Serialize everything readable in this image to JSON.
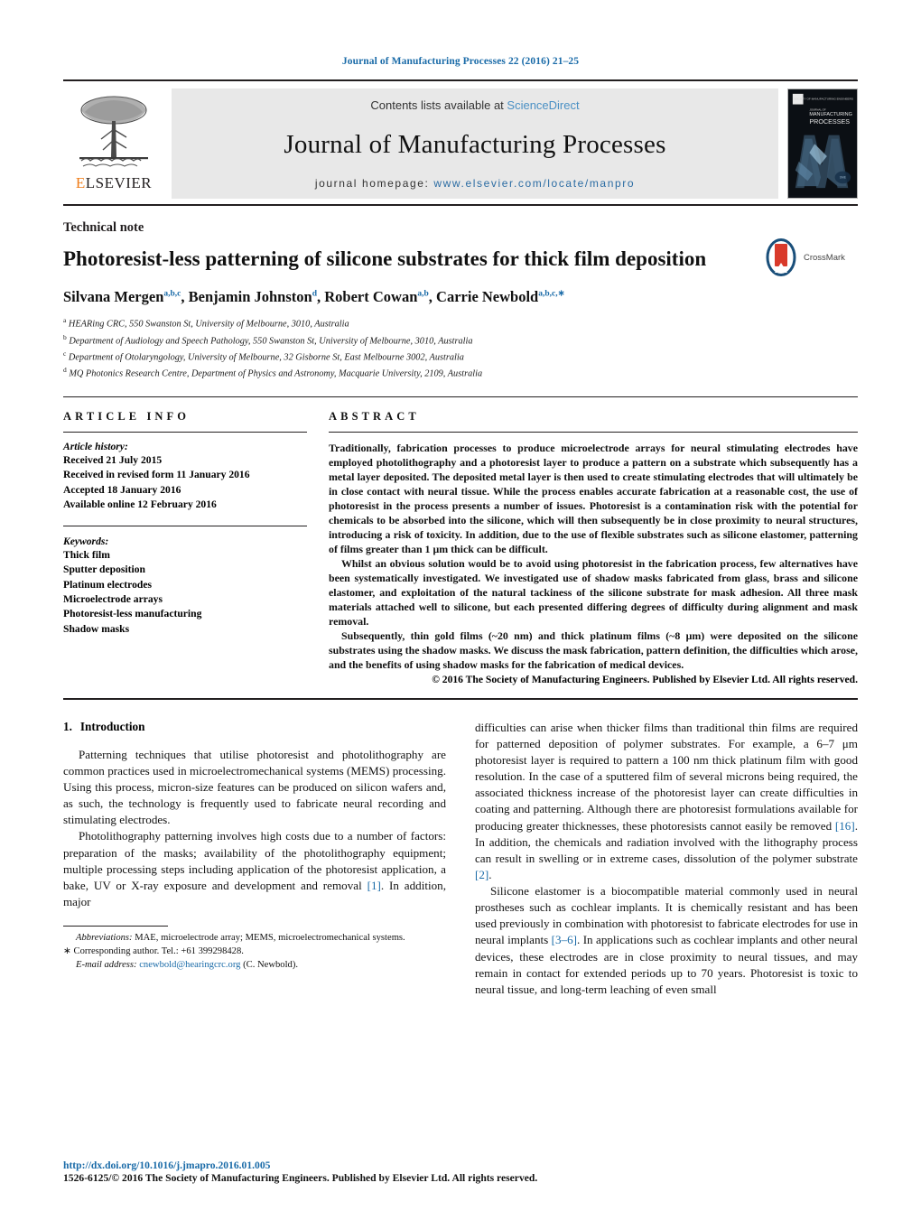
{
  "running_head": "Journal of Manufacturing Processes 22 (2016) 21–25",
  "masthead": {
    "contents_prefix": "Contents lists available at ",
    "sciencedirect": "ScienceDirect",
    "journal_title": "Journal of Manufacturing Processes",
    "homepage_prefix": "journal homepage: ",
    "homepage_url": "www.elsevier.com/locate/manpro",
    "publisher": "ELSEVIER",
    "cover_title_small": "JOURNAL OF",
    "cover_title_1": "MANUFACTURING",
    "cover_title_2": "PROCESSES"
  },
  "article": {
    "doctype": "Technical note",
    "title": "Photoresist-less patterning of silicone substrates for thick film deposition",
    "crossmark_label": "CrossMark",
    "authors": [
      {
        "name": "Silvana Mergen",
        "sup": "a,b,c"
      },
      {
        "name": "Benjamin Johnston",
        "sup": "d"
      },
      {
        "name": "Robert Cowan",
        "sup": "a,b"
      },
      {
        "name": "Carrie Newbold",
        "sup": "a,b,c,∗"
      }
    ],
    "affiliations": [
      {
        "mark": "a",
        "text": "HEARing CRC, 550 Swanston St, University of Melbourne, 3010, Australia"
      },
      {
        "mark": "b",
        "text": "Department of Audiology and Speech Pathology, 550 Swanston St, University of Melbourne, 3010, Australia"
      },
      {
        "mark": "c",
        "text": "Department of Otolaryngology, University of Melbourne, 32 Gisborne St, East Melbourne 3002, Australia"
      },
      {
        "mark": "d",
        "text": "MQ Photonics Research Centre, Department of Physics and Astronomy, Macquarie University, 2109, Australia"
      }
    ]
  },
  "article_info": {
    "heading": "ARTICLE INFO",
    "history_label": "Article history:",
    "history": [
      "Received 21 July 2015",
      "Received in revised form 11 January 2016",
      "Accepted 18 January 2016",
      "Available online 12 February 2016"
    ],
    "keywords_label": "Keywords:",
    "keywords": [
      "Thick film",
      "Sputter deposition",
      "Platinum electrodes",
      "Microelectrode arrays",
      "Photoresist-less manufacturing",
      "Shadow masks"
    ]
  },
  "abstract": {
    "heading": "ABSTRACT",
    "paragraphs": [
      "Traditionally, fabrication processes to produce microelectrode arrays for neural stimulating electrodes have employed photolithography and a photoresist layer to produce a pattern on a substrate which subsequently has a metal layer deposited. The deposited metal layer is then used to create stimulating electrodes that will ultimately be in close contact with neural tissue. While the process enables accurate fabrication at a reasonable cost, the use of photoresist in the process presents a number of issues. Photoresist is a contamination risk with the potential for chemicals to be absorbed into the silicone, which will then subsequently be in close proximity to neural structures, introducing a risk of toxicity. In addition, due to the use of flexible substrates such as silicone elastomer, patterning of films greater than 1 μm thick can be difficult.",
      "Whilst an obvious solution would be to avoid using photoresist in the fabrication process, few alternatives have been systematically investigated. We investigated use of shadow masks fabricated from glass, brass and silicone elastomer, and exploitation of the natural tackiness of the silicone substrate for mask adhesion. All three mask materials attached well to silicone, but each presented differing degrees of difficulty during alignment and mask removal.",
      "Subsequently, thin gold films (~20 nm) and thick platinum films (~8 μm) were deposited on the silicone substrates using the shadow masks. We discuss the mask fabrication, pattern definition, the difficulties which arose, and the benefits of using shadow masks for the fabrication of medical devices."
    ],
    "copyright": "© 2016 The Society of Manufacturing Engineers. Published by Elsevier Ltd. All rights reserved."
  },
  "body": {
    "section_number": "1.",
    "section_title": "Introduction",
    "left_paragraphs": [
      "Patterning techniques that utilise photoresist and photolithography are common practices used in microelectromechanical systems (MEMS) processing. Using this process, micron-size features can be produced on silicon wafers and, as such, the technology is frequently used to fabricate neural recording and stimulating electrodes.",
      "Photolithography patterning involves high costs due to a number of factors: preparation of the masks; availability of the photolithography equipment; multiple processing steps including application of the photoresist application, a bake, UV or X-ray exposure and development and removal [1]. In addition, major"
    ],
    "right_paragraphs": [
      "difficulties can arise when thicker films than traditional thin films are required for patterned deposition of polymer substrates. For example, a 6–7 μm photoresist layer is required to pattern a 100 nm thick platinum film with good resolution. In the case of a sputtered film of several microns being required, the associated thickness increase of the photoresist layer can create difficulties in coating and patterning. Although there are photoresist formulations available for producing greater thicknesses, these photoresists cannot easily be removed [16]. In addition, the chemicals and radiation involved with the lithography process can result in swelling or in extreme cases, dissolution of the polymer substrate [2].",
      "Silicone elastomer is a biocompatible material commonly used in neural prostheses such as cochlear implants. It is chemically resistant and has been used previously in combination with photoresist to fabricate electrodes for use in neural implants [3–6]. In applications such as cochlear implants and other neural devices, these electrodes are in close proximity to neural tissues, and may remain in contact for extended periods up to 70 years. Photoresist is toxic to neural tissue, and long-term leaching of even small"
    ]
  },
  "footnotes": {
    "abbreviations_label": "Abbreviations:",
    "abbreviations_text": "MAE, microelectrode array; MEMS, microelectromechanical systems.",
    "corresponding_marker": "∗",
    "corresponding_text": "Corresponding author. Tel.: +61 399298428.",
    "email_label": "E-mail address:",
    "email": "cnewbold@hearingcrc.org",
    "email_suffix": "(C. Newbold)."
  },
  "footer": {
    "doi": "http://dx.doi.org/10.1016/j.jmapro.2016.01.005",
    "issn_line": "1526-6125/© 2016 The Society of Manufacturing Engineers. Published by Elsevier Ltd. All rights reserved."
  },
  "colors": {
    "link": "#1a6ba8",
    "accent_orange": "#ef7d1a",
    "masthead_bg": "#e8e8e8"
  }
}
